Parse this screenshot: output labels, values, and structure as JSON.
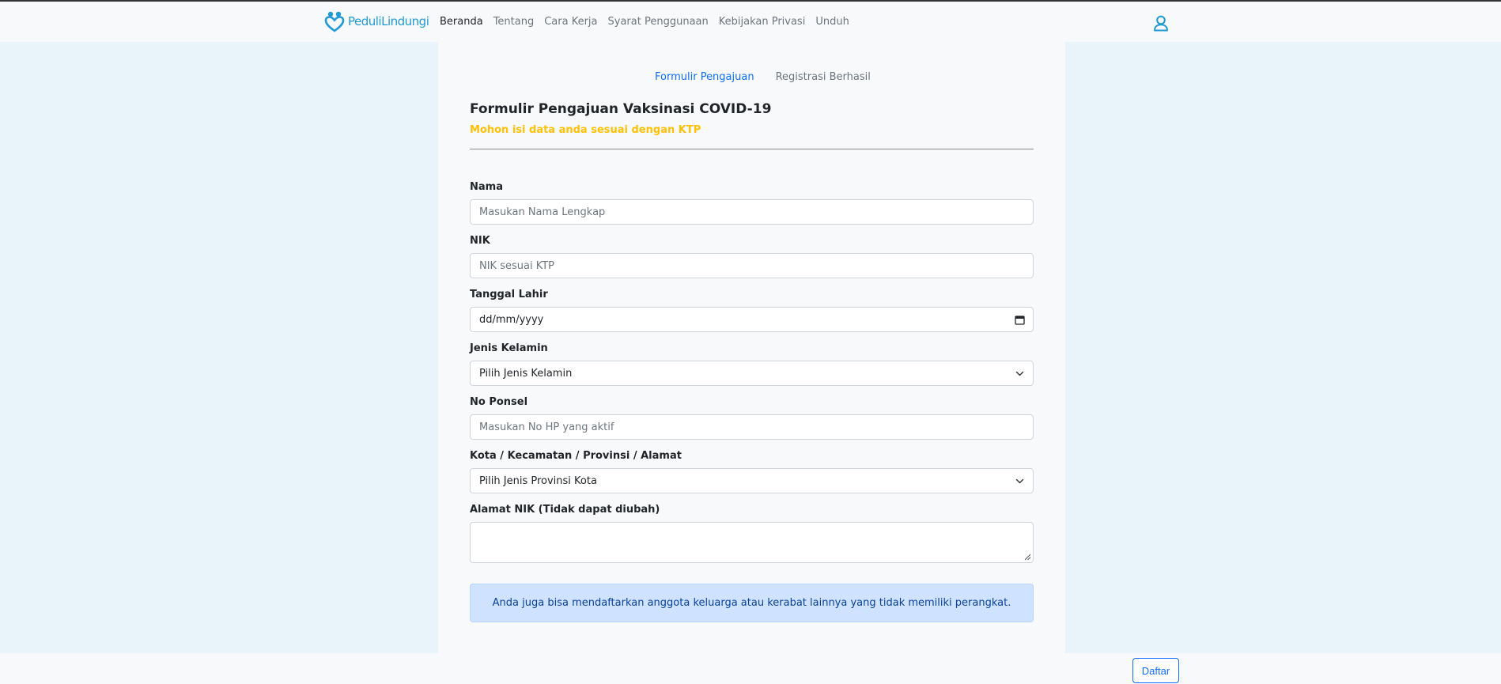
{
  "navbar": {
    "brand": "PeduliLindungi",
    "links": [
      "Beranda",
      "Tentang",
      "Cara Kerja",
      "Syarat Penggunaan",
      "Kebijakan Privasi",
      "Unduh"
    ],
    "active_link": "Beranda"
  },
  "steps": [
    "Formulir Pengajuan",
    "Registrasi Berhasil"
  ],
  "form": {
    "title": "Formulir Pengajuan Vaksinasi COVID-19",
    "subtitle": "Mohon isi data anda sesuai dengan KTP",
    "fields": {
      "nama": {
        "label": "Nama",
        "placeholder": "Masukan Nama Lengkap"
      },
      "nik": {
        "label": "NIK",
        "placeholder": "NIK sesuai KTP"
      },
      "tanggal_lahir": {
        "label": "Tanggal Lahir",
        "value": "dd/mm/yyyy"
      },
      "jenis_kelamin": {
        "label": "Jenis Kelamin",
        "selected": "Pilih Jenis Kelamin"
      },
      "no_ponsel": {
        "label": "No Ponsel",
        "placeholder": "Masukan No HP yang aktif"
      },
      "lokasi": {
        "label": "Kota / Kecamatan / Provinsi / Alamat",
        "selected": "Pilih Jenis Provinsi Kota"
      },
      "alamat_nik": {
        "label": "Alamat NIK (Tidak dapat diubah)",
        "value": ""
      }
    },
    "info": "Anda juga bisa mendaftarkan anggota keluarga atau kerabat lainnya yang tidak memiliki perangkat.",
    "submit_label": "Daftar"
  },
  "colors": {
    "brand": "#1e9ad6",
    "accent": "#0d6efd",
    "warning": "#ffc107",
    "info_bg": "#cfe2ff",
    "side_bg": "#e9f4fa"
  },
  "icons": [
    "brand-logo-icon",
    "user-icon",
    "calendar-icon",
    "chevron-down-icon",
    "resize-grip-icon"
  ]
}
